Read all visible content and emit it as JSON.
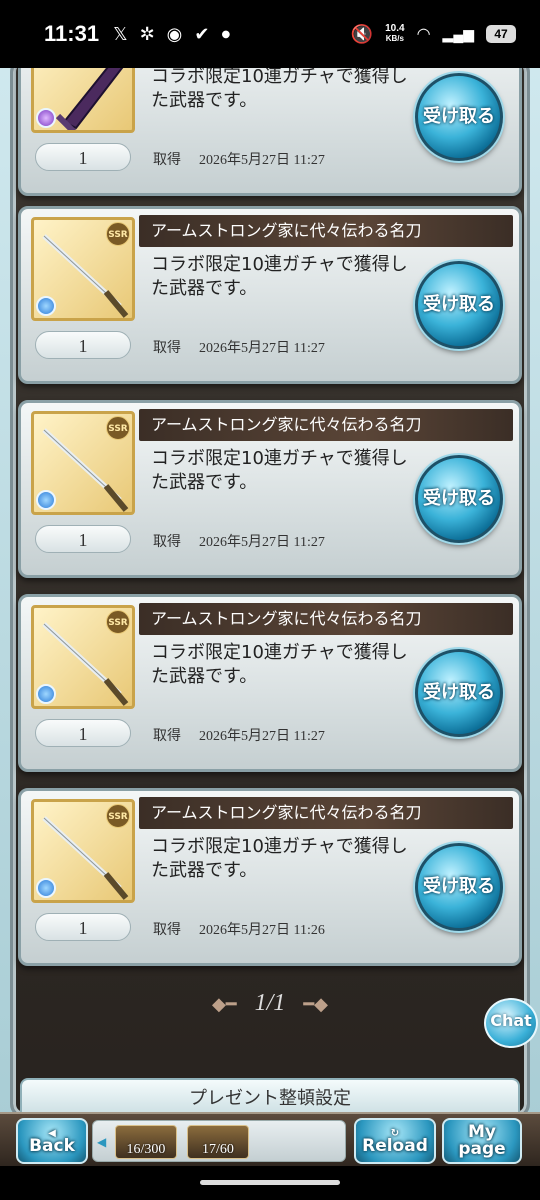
{
  "status": {
    "time": "11:31",
    "net_speed_value": "10.4",
    "net_speed_unit": "KB/s",
    "battery": "47"
  },
  "cards": [
    {
      "title": "",
      "desc": "コラボ限定10連ガチャで獲得した武器です。",
      "qty": "1",
      "obtained_label": "取得",
      "date": "2026年5月27日 11:27",
      "receive_label": "受け取る",
      "rarity": "",
      "weapon": "dark-sword-icon"
    },
    {
      "title": "アームストロング家に代々伝わる名刀",
      "desc": "コラボ限定10連ガチャで獲得した武器です。",
      "qty": "1",
      "obtained_label": "取得",
      "date": "2026年5月27日 11:27",
      "receive_label": "受け取る",
      "rarity": "SSR",
      "weapon": "katana-icon"
    },
    {
      "title": "アームストロング家に代々伝わる名刀",
      "desc": "コラボ限定10連ガチャで獲得した武器です。",
      "qty": "1",
      "obtained_label": "取得",
      "date": "2026年5月27日 11:27",
      "receive_label": "受け取る",
      "rarity": "SSR",
      "weapon": "katana-icon"
    },
    {
      "title": "アームストロング家に代々伝わる名刀",
      "desc": "コラボ限定10連ガチャで獲得した武器です。",
      "qty": "1",
      "obtained_label": "取得",
      "date": "2026年5月27日 11:27",
      "receive_label": "受け取る",
      "rarity": "SSR",
      "weapon": "katana-icon"
    },
    {
      "title": "アームストロング家に代々伝わる名刀",
      "desc": "コラボ限定10連ガチャで獲得した武器です。",
      "qty": "1",
      "obtained_label": "取得",
      "date": "2026年5月27日 11:26",
      "receive_label": "受け取る",
      "rarity": "SSR",
      "weapon": "katana-icon"
    }
  ],
  "pager": "1/1",
  "chat_label": "Chat",
  "settings_label": "プレゼント整頓設定",
  "bottom": {
    "back_label": "Back",
    "reload_label": "Reload",
    "mypage_line1": "My",
    "mypage_line2": "page",
    "stock1": "16/300",
    "stock2": "17/60"
  }
}
